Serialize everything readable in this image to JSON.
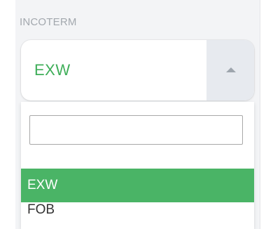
{
  "field": {
    "label": "INCOTERM",
    "selected_value": "EXW"
  },
  "dropdown": {
    "search_value": "",
    "options": [
      {
        "label": "EXW",
        "selected": true
      },
      {
        "label": "FOB",
        "selected": false
      }
    ]
  },
  "colors": {
    "accent_green": "#4ab466",
    "selected_text_green": "#3fae59",
    "panel_bg": "#f3f4f6",
    "toggle_bg": "#e7eaef"
  },
  "icons": {
    "toggle": "caret-up-icon"
  }
}
